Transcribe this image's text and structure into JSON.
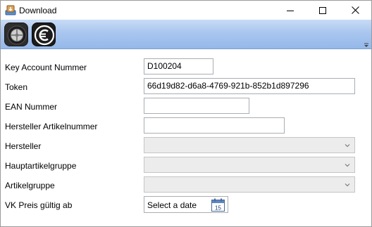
{
  "window": {
    "title": "Download",
    "controls": {
      "minimize": "minimize",
      "maximize": "maximize",
      "close": "close"
    }
  },
  "toolbar": {
    "buttons": [
      {
        "icon": "tire-icon"
      },
      {
        "icon": "euro-icon"
      }
    ]
  },
  "form": {
    "fields": [
      {
        "label": "Key Account Nummer",
        "value": "D100204"
      },
      {
        "label": "Token",
        "value": "66d19d82-d6a8-4769-921b-852b1d897296"
      },
      {
        "label": "EAN Nummer",
        "value": ""
      },
      {
        "label": "Hersteller Artikelnummer",
        "value": ""
      },
      {
        "label": "Hersteller",
        "value": ""
      },
      {
        "label": "Hauptartikelgruppe",
        "value": ""
      },
      {
        "label": "Artikelgruppe",
        "value": ""
      },
      {
        "label": "VK Preis gültig ab",
        "placeholder": "Select a date",
        "calendar_day": "15"
      }
    ]
  }
}
